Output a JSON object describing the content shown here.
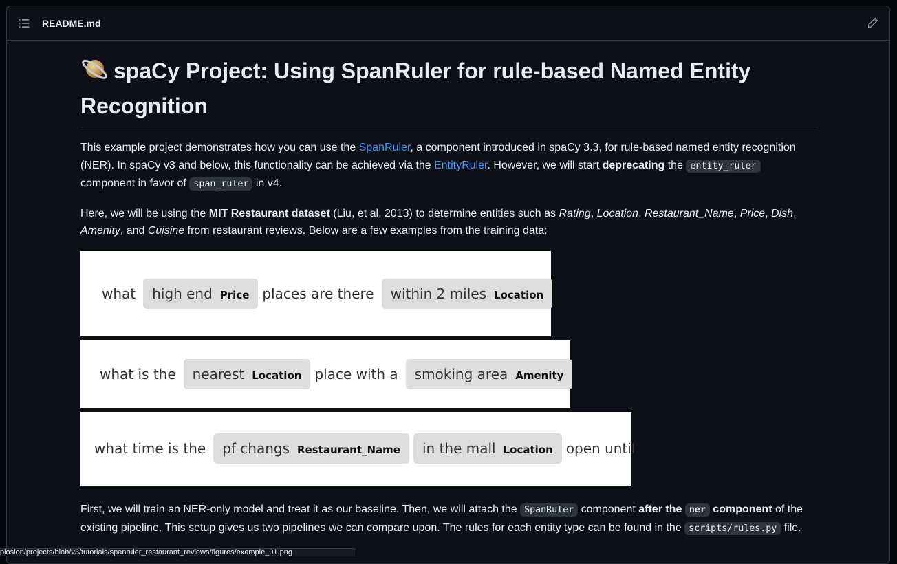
{
  "header": {
    "file_name": "README.md",
    "toc_icon": "list-unordered-icon",
    "edit_icon": "pencil-icon"
  },
  "title": {
    "emoji": "planet-icon",
    "text": "spaCy Project: Using SpanRuler for rule-based Named Entity Recognition"
  },
  "intro": {
    "t1": "This example project demonstrates how you can use the ",
    "link_spanruler": "SpanRuler",
    "t2": ", a component introduced in spaCy 3.3, for rule-based named entity recognition (NER). In spaCy v3 and below, this functionality can be achieved via the ",
    "link_entityruler": "EntityRuler",
    "t3": ". However, we will start ",
    "bold_deprecating": "deprecating",
    "t4": " the ",
    "code_entity_ruler": "entity_ruler",
    "t5": " component in favor of ",
    "code_span_ruler": "span_ruler",
    "t6": " in v4."
  },
  "dataset_para": {
    "t1": "Here, we will be using the ",
    "bold_dataset": "MIT Restaurant dataset",
    "t2": " (Liu, et al, 2013) to determine entities such as ",
    "e_rating": "Rating",
    "sep1": ", ",
    "e_location": "Location",
    "sep2": ", ",
    "e_restaurant": "Restaurant_Name",
    "sep3": ", ",
    "e_price": "Price",
    "sep4": ", ",
    "e_dish": "Dish",
    "sep5": ", ",
    "e_amenity": "Amenity",
    "sep6": ", and ",
    "e_cuisine": "Cuisine",
    "t3": " from restaurant reviews. Below are a few examples from the training data:"
  },
  "examples": [
    {
      "w1": "what",
      "ent1_text": "high end",
      "ent1_label": "Price",
      "w2": "places are there",
      "ent2_text": "within 2 miles",
      "ent2_label": "Location"
    },
    {
      "w1": "what is the",
      "ent1_text": "nearest",
      "ent1_label": "Location",
      "w2": "place with a",
      "ent2_text": "smoking area",
      "ent2_label": "Amenity"
    },
    {
      "w1": "what time is the",
      "ent1_text": "pf changs",
      "ent1_label": "Restaurant_Name",
      "ent2_text": "in the mall",
      "ent2_label": "Location",
      "w3": "open until"
    }
  ],
  "pipeline_para": {
    "t1": "First, we will train an NER-only model and treat it as our baseline. Then, we will attach the ",
    "code_spanruler": "SpanRuler",
    "t2": " component ",
    "bold_after": "after the ",
    "code_ner": "ner",
    "bold_component": "component",
    "t3": " of the existing pipeline. This setup gives us two pipelines we can compare upon. The rules for each entity type can be found in the ",
    "code_rules": "scripts/rules.py",
    "t4": " file."
  },
  "status_url": "plosion/projects/blob/v3/tutorials/spanruler_restaurant_reviews/figures/example_01.png"
}
